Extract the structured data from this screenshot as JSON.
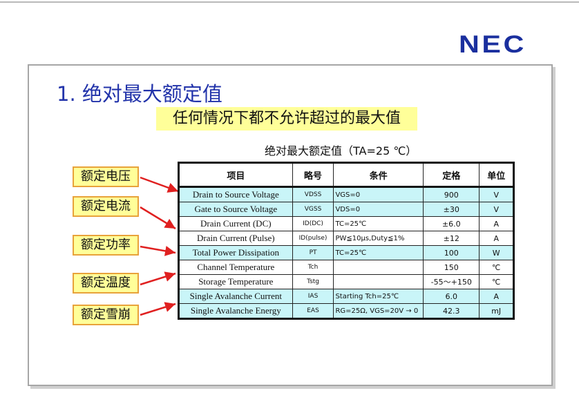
{
  "logo": "NEC",
  "title": "1. 绝对最大额定值",
  "banner": "任何情况下都不允许超过的最大值",
  "table_title": "绝对最大额定值（TA=25 ℃）",
  "callouts": [
    "额定电压",
    "额定电流",
    "额定功率",
    "额定温度",
    "额定雪崩"
  ],
  "headers": [
    "项目",
    "略号",
    "条件",
    "定格",
    "单位"
  ],
  "rows": [
    {
      "param": "Drain to Source Voltage",
      "sym": "VDSS",
      "cond": "VGS=0",
      "rating": "900",
      "unit": "V"
    },
    {
      "param": "Gate to Source Voltage",
      "sym": "VGSS",
      "cond": "VDS=0",
      "rating": "±30",
      "unit": "V"
    },
    {
      "param": "Drain Current (DC)",
      "sym": "ID(DC)",
      "cond": "TC=25℃",
      "rating": "±6.0",
      "unit": "A"
    },
    {
      "param": "Drain Current (Pulse)",
      "sym": "ID(pulse)",
      "cond": "PW≦10μs,Duty≦1%",
      "rating": "±12",
      "unit": "A"
    },
    {
      "param": "Total Power Dissipation",
      "sym": "PT",
      "cond": "TC=25℃",
      "rating": "100",
      "unit": "W"
    },
    {
      "param": "Channel Temperature",
      "sym": "Tch",
      "cond": "",
      "rating": "150",
      "unit": "℃"
    },
    {
      "param": "Storage Temperature",
      "sym": "Tstg",
      "cond": "",
      "rating": "-55～+150",
      "unit": "℃"
    },
    {
      "param": "Single Avalanche Current",
      "sym": "IAS",
      "cond": "Starting Tch=25℃",
      "rating": "6.0",
      "unit": "A"
    },
    {
      "param": "Single Avalanche Energy",
      "sym": "EAS",
      "cond": "RG=25Ω, VGS=20V → 0",
      "rating": "42.3",
      "unit": "mJ"
    }
  ],
  "colors": {
    "title": "#2233aa",
    "logo": "#1a2f9e",
    "highlight": "#c9f5f8",
    "banner": "#ffff99",
    "arrow": "#e02020"
  }
}
